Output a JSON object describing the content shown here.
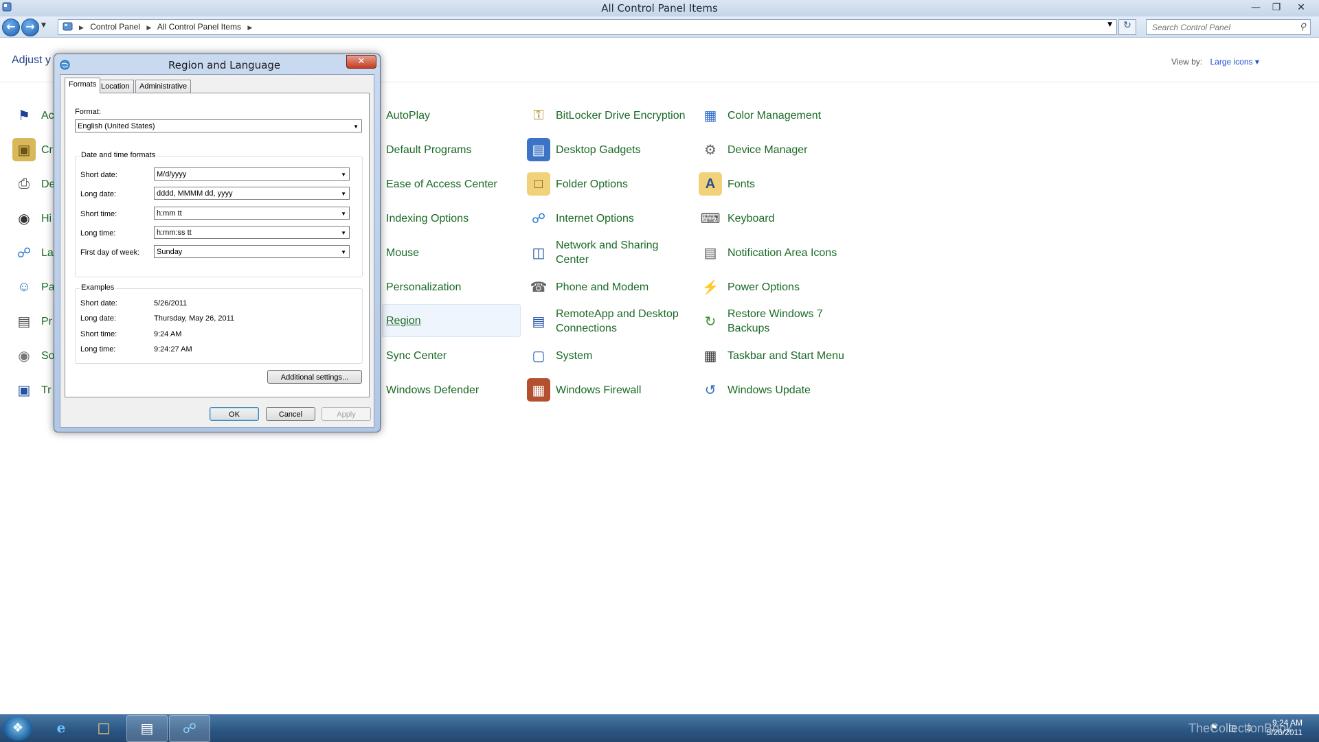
{
  "window": {
    "title": "All Control Panel Items",
    "back_icon": "back-arrow-icon",
    "forward_icon": "forward-arrow-icon"
  },
  "address": {
    "crumbs": [
      "Control Panel",
      "All Control Panel Items"
    ],
    "search_placeholder": "Search Control Panel"
  },
  "content": {
    "adjust_label": "Adjust y",
    "view_by_label": "View by:",
    "view_by_value": "Large icons"
  },
  "hidden_items": [
    "Ac",
    "Cr",
    "De",
    "Hi",
    "La",
    "Pa",
    "Pr",
    "So",
    "Tr"
  ],
  "items": {
    "col1": [
      "AutoPlay",
      "Default Programs",
      "Ease of Access Center",
      "Indexing Options",
      "Mouse",
      "Personalization",
      "Region",
      "Sync Center",
      "Windows Defender"
    ],
    "col2": [
      "BitLocker Drive Encryption",
      "Desktop Gadgets",
      "Folder Options",
      "Internet Options",
      "Network and Sharing Center",
      "Phone and Modem",
      "RemoteApp and Desktop Connections",
      "System",
      "Windows Firewall"
    ],
    "col3": [
      "Color Management",
      "Device Manager",
      "Fonts",
      "Keyboard",
      "Notification Area Icons",
      "Power Options",
      "Restore Windows 7 Backups",
      "Taskbar and Start Menu",
      "Windows Update"
    ]
  },
  "dialog": {
    "title": "Region and Language",
    "tabs": [
      "Formats",
      "Location",
      "Administrative"
    ],
    "format_label": "Format:",
    "format_value": "English (United States)",
    "datetime_group": "Date and time formats",
    "fields": [
      {
        "label": "Short date:",
        "value": "M/d/yyyy"
      },
      {
        "label": "Long date:",
        "value": "dddd, MMMM dd, yyyy"
      },
      {
        "label": "Short time:",
        "value": "h:mm tt"
      },
      {
        "label": "Long time:",
        "value": "h:mm:ss tt"
      },
      {
        "label": "First day of week:",
        "value": "Sunday"
      }
    ],
    "examples_group": "Examples",
    "examples": [
      {
        "label": "Short date:",
        "value": "5/26/2011"
      },
      {
        "label": "Long date:",
        "value": "Thursday, May 26, 2011"
      },
      {
        "label": "Short time:",
        "value": "9:24 AM"
      },
      {
        "label": "Long time:",
        "value": "9:24:27 AM"
      }
    ],
    "additional_button": "Additional settings...",
    "ok": "OK",
    "cancel": "Cancel",
    "apply": "Apply"
  },
  "taskbar": {
    "time": "9:24 AM",
    "date": "5/26/2011",
    "watermark": "TheCollectionBook"
  }
}
